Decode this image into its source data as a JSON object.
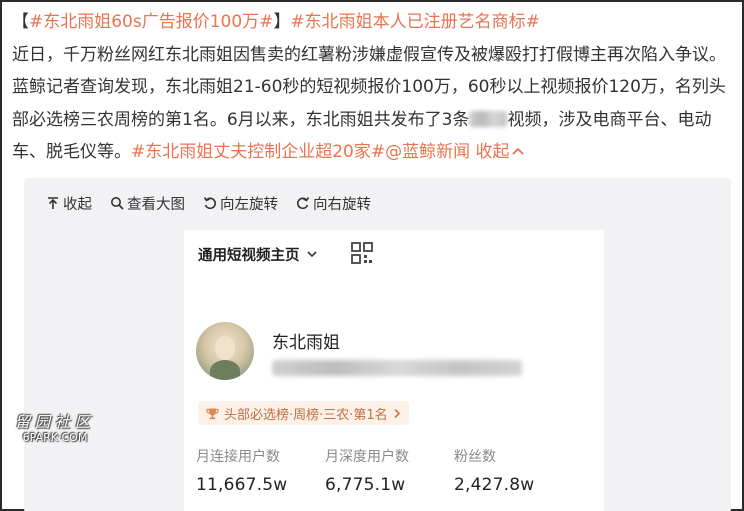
{
  "post": {
    "bracket_open": "【",
    "tag1": "#东北雨姐60s广告报价100万#",
    "bracket_close": "】",
    "tag2": "#东北雨姐本人已注册艺名商标#",
    "body_part1": "近日，千万粉丝网红东北雨姐因售卖的红薯粉涉嫌虚假宣传及被爆殴打打假博主再次陷入争议。蓝鲸记者查询发现，东北雨姐21-60秒的短视频报价100万，60秒以上视频报价120万，名列头部必选榜三农周榜的第1名。6月以来，东北雨姐共发布了3条",
    "body_part2": "视频，涉及电商平台、电动车、脱毛仪等。",
    "tag3": "#东北雨姐丈夫控制企业超20家#",
    "mention": "@蓝鲸新闻",
    "collapse": "收起",
    "collapse_icon": "chevron-up-icon"
  },
  "viewer_toolbar": {
    "collapse": "收起",
    "view_large": "查看大图",
    "rotate_left": "向左旋转",
    "rotate_right": "向右旋转"
  },
  "screenshot": {
    "nav_title": "通用短视频主页",
    "nav_icon": "chevron-down-icon",
    "qr_icon": "qr-code-icon",
    "username": "东北雨姐",
    "rank_badge": "头部必选榜·周榜·三农·第1名",
    "stats": [
      {
        "label": "月连接用户数",
        "value": "11,667.5w"
      },
      {
        "label": "月深度用户数",
        "value": "6,775.1w"
      },
      {
        "label": "粉丝数",
        "value": "2,427.8w"
      }
    ]
  },
  "watermark": {
    "cn": "留园社区",
    "en": "6PARK·COM"
  },
  "colors": {
    "tag": "#eb7350",
    "text": "#333333",
    "panel_bg": "#f2f2f5",
    "rank_bg": "#fdf0e6",
    "rank_text": "#c0704a"
  }
}
